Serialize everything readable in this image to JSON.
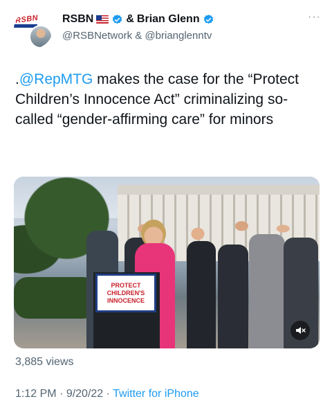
{
  "header": {
    "avatar_logo_text": "RSBN",
    "author1_name": "RSBN",
    "author_connector": "&",
    "author2_name": "Brian Glenn",
    "handles": "@RSBNetwork & @brianglenntv",
    "more_label": "···"
  },
  "tweet": {
    "prefix": ".",
    "mention": "@RepMTG",
    "text": " makes the case for the “Protect Children’s Innocence Act” criminalizing so-called “gender-affirming care” for minors"
  },
  "media": {
    "podium_sign": "PROTECT\nCHILDREN'S\nINNOCENCE",
    "mute_icon": "mute-icon"
  },
  "stats": {
    "views": "3,885 views"
  },
  "meta": {
    "time": "1:12 PM",
    "date": "9/20/22",
    "separator": " · ",
    "app": "Twitter for iPhone"
  },
  "colors": {
    "accent": "#1d9bf0",
    "secondary_text": "#536471",
    "verified_badge": "#1d9bf0",
    "speaker_jacket": "#e8357a"
  }
}
